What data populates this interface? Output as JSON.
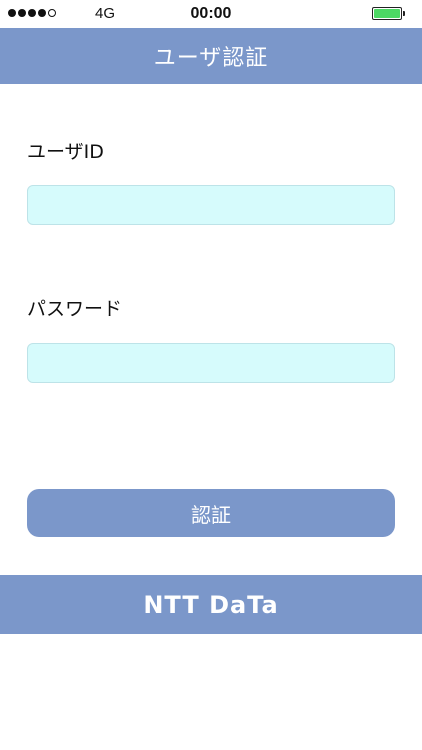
{
  "status_bar": {
    "signal_bars_filled": 4,
    "signal_bars_total": 5,
    "network": "4G",
    "time": "00:00",
    "battery_level": 1.0,
    "battery_color": "#4cd964"
  },
  "header": {
    "title": "ユーザ認証",
    "background": "#7b97ca"
  },
  "form": {
    "user_id_label": "ユーザID",
    "user_id_value": "",
    "password_label": "パスワード",
    "password_value": "",
    "input_background": "#d6fbfc",
    "submit_label": "認証"
  },
  "footer": {
    "logo_text": "NTT DaTa",
    "background": "#7b97ca"
  }
}
